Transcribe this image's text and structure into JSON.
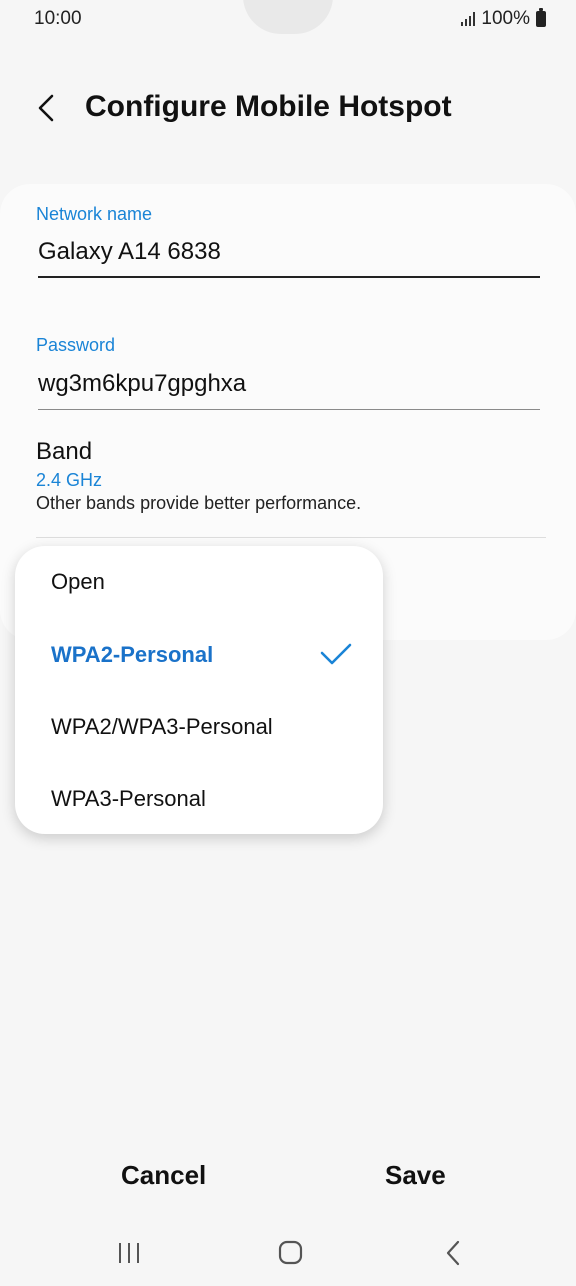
{
  "status_bar": {
    "time": "10:00",
    "battery": "100%"
  },
  "header": {
    "title": "Configure Mobile Hotspot"
  },
  "network_name": {
    "label": "Network name",
    "value": "Galaxy A14 6838"
  },
  "password": {
    "label": "Password",
    "value": "wg3m6kpu7gpghxa"
  },
  "band": {
    "title": "Band",
    "value": "2.4 GHz",
    "note": "Other bands provide better performance."
  },
  "security_dropdown": {
    "options": [
      "Open",
      "WPA2-Personal",
      "WPA2/WPA3-Personal",
      "WPA3-Personal"
    ],
    "selected": "WPA2-Personal"
  },
  "actions": {
    "cancel": "Cancel",
    "save": "Save"
  },
  "colors": {
    "accent": "#1a84d6",
    "selected": "#1a72c9",
    "background": "#f6f6f6",
    "card": "#fbfbfb"
  },
  "icons": [
    "back-arrow-icon",
    "signal-icon",
    "battery-icon",
    "checkmark-icon",
    "recents-icon",
    "home-icon",
    "nav-back-icon"
  ]
}
